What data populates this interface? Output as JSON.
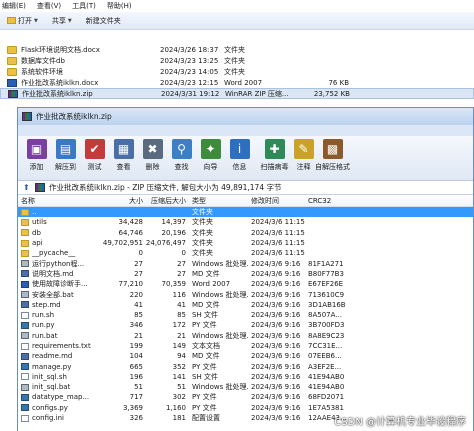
{
  "explorer": {
    "menu": [
      "编辑(E)",
      "查看(V)",
      "工具(T)",
      "帮助(H)"
    ],
    "toolbar": {
      "open": "打开",
      "share": "共享",
      "new_folder": "新建文件夹"
    },
    "files": [
      {
        "name": "Flask环境说明文档.docx",
        "date": "2024/3/26 18:37",
        "type": "文件夹",
        "size": "",
        "icon": "folder-icon"
      },
      {
        "name": "数据库文件db",
        "date": "2024/3/23 13:25",
        "type": "文件夹",
        "size": "",
        "icon": "folder-icon"
      },
      {
        "name": "系统软件环境",
        "date": "2024/3/23 14:05",
        "type": "文件夹",
        "size": "",
        "icon": "folder-icon"
      },
      {
        "name": "作业批改系统iklkn.docx",
        "date": "2024/3/23 12:15",
        "type": "Word 2007",
        "size": "76 KB",
        "icon": "word-doc-icon"
      },
      {
        "name": "作业批改系统iklkn.zip",
        "date": "2024/3/31 19:12",
        "type": "WinRAR ZIP 压缩...",
        "size": "23,752 KB",
        "icon": "winrar-zip-icon"
      }
    ]
  },
  "winrar": {
    "title": "作业批改系统iklkn.zip",
    "toolbar": [
      {
        "label": "添加",
        "icon": "add-icon",
        "color": "#7a3fa0",
        "glyph": "▣"
      },
      {
        "label": "解压到",
        "icon": "extract-to-icon",
        "color": "#3a78c8",
        "glyph": "▤"
      },
      {
        "label": "测试",
        "icon": "test-icon",
        "color": "#c43b3b",
        "glyph": "✔"
      },
      {
        "label": "查看",
        "icon": "view-icon",
        "color": "#4a6fa8",
        "glyph": "▦"
      },
      {
        "label": "删除",
        "icon": "delete-icon",
        "color": "#5a6b80",
        "glyph": "✖"
      },
      {
        "label": "查找",
        "icon": "find-icon",
        "color": "#3b7fc4",
        "glyph": "⚲"
      },
      {
        "label": "向导",
        "icon": "wizard-icon",
        "color": "#3c8c3c",
        "glyph": "✦"
      },
      {
        "label": "信息",
        "icon": "info-icon",
        "color": "#2f6fbf",
        "glyph": "i"
      },
      {
        "label": "扫描病毒",
        "icon": "virus-scan-icon",
        "color": "#2e8b57",
        "glyph": "✚"
      },
      {
        "label": "注释",
        "icon": "comment-icon",
        "color": "#c9a227",
        "glyph": "✎"
      },
      {
        "label": "自解压格式",
        "icon": "sfx-icon",
        "color": "#8a5a2b",
        "glyph": "▩"
      }
    ],
    "address": "作业批改系统iklkn.zip - ZIP 压缩文件, 解包大小为 49,891,174 字节",
    "columns": {
      "name": "名称",
      "size": "大小",
      "packed": "压缩后大小",
      "type": "类型",
      "modified": "修改时间",
      "crc": "CRC32"
    },
    "rows": [
      {
        "name": "..",
        "size": "",
        "packed": "",
        "type": "文件夹",
        "modified": "",
        "crc": "",
        "icon": "updir",
        "selected": true
      },
      {
        "name": "utils",
        "size": "34,428",
        "packed": "14,397",
        "type": "文件夹",
        "modified": "2024/3/6 11:15",
        "crc": "",
        "icon": "folder"
      },
      {
        "name": "db",
        "size": "64,746",
        "packed": "20,196",
        "type": "文件夹",
        "modified": "2024/3/6 11:15",
        "crc": "",
        "icon": "folder"
      },
      {
        "name": "api",
        "size": "49,702,951",
        "packed": "24,076,497",
        "type": "文件夹",
        "modified": "2024/3/6 11:15",
        "crc": "",
        "icon": "folder"
      },
      {
        "name": "__pycache__",
        "size": "0",
        "packed": "0",
        "type": "文件夹",
        "modified": "2024/3/6 11:15",
        "crc": "",
        "icon": "folder"
      },
      {
        "name": "运行python程...",
        "size": "27",
        "packed": "27",
        "type": "Windows 批处理...",
        "modified": "2024/3/6 9:16",
        "crc": "81F1A271",
        "icon": "bat"
      },
      {
        "name": "说明文档.md",
        "size": "27",
        "packed": "27",
        "type": "MD 文件",
        "modified": "2024/3/6 9:16",
        "crc": "B80F77B3",
        "icon": "md"
      },
      {
        "name": "使用故障诊断手...",
        "size": "77,210",
        "packed": "70,359",
        "type": "Word 2007",
        "modified": "2024/3/6 9:16",
        "crc": "E67EF26E",
        "icon": "docx"
      },
      {
        "name": "安装全部.bat",
        "size": "220",
        "packed": "116",
        "type": "Windows 批处理...",
        "modified": "2024/3/6 9:16",
        "crc": "713610C9",
        "icon": "bat"
      },
      {
        "name": "step.md",
        "size": "41",
        "packed": "41",
        "type": "MD 文件",
        "modified": "2024/3/6 9:16",
        "crc": "3D1AB16B",
        "icon": "md"
      },
      {
        "name": "run.sh",
        "size": "85",
        "packed": "85",
        "type": "SH 文件",
        "modified": "2024/3/6 9:16",
        "crc": "8A507A...",
        "icon": "sh"
      },
      {
        "name": "run.py",
        "size": "346",
        "packed": "172",
        "type": "PY 文件",
        "modified": "2024/3/6 9:16",
        "crc": "3B700FD3",
        "icon": "py"
      },
      {
        "name": "run.bat",
        "size": "21",
        "packed": "21",
        "type": "Windows 批处理...",
        "modified": "2024/3/6 9:16",
        "crc": "8A8E9C23",
        "icon": "bat"
      },
      {
        "name": "requirements.txt",
        "size": "199",
        "packed": "149",
        "type": "文本文档",
        "modified": "2024/3/6 9:16",
        "crc": "7CC31E...",
        "icon": "txt"
      },
      {
        "name": "readme.md",
        "size": "104",
        "packed": "94",
        "type": "MD 文件",
        "modified": "2024/3/6 9:16",
        "crc": "07EEB6...",
        "icon": "md"
      },
      {
        "name": "manage.py",
        "size": "665",
        "packed": "352",
        "type": "PY 文件",
        "modified": "2024/3/6 9:16",
        "crc": "A3EF2E...",
        "icon": "py"
      },
      {
        "name": "init_sql.sh",
        "size": "196",
        "packed": "141",
        "type": "SH 文件",
        "modified": "2024/3/6 9:16",
        "crc": "41E94AB0",
        "icon": "sh"
      },
      {
        "name": "init_sql.bat",
        "size": "51",
        "packed": "51",
        "type": "Windows 批处理...",
        "modified": "2024/3/6 9:16",
        "crc": "41E94AB0",
        "icon": "bat"
      },
      {
        "name": "datatype_map...",
        "size": "717",
        "packed": "302",
        "type": "PY 文件",
        "modified": "2024/3/6 9:16",
        "crc": "68FD2071",
        "icon": "py"
      },
      {
        "name": "configs.py",
        "size": "3,369",
        "packed": "1,160",
        "type": "PY 文件",
        "modified": "2024/3/6 9:16",
        "crc": "1E7A5381",
        "icon": "py"
      },
      {
        "name": "config.ini",
        "size": "326",
        "packed": "181",
        "type": "配置设置",
        "modified": "2024/3/6 9:16",
        "crc": "12AAE43...",
        "icon": "txt"
      }
    ]
  },
  "watermark": "CSDN @计算机专业毕设程序"
}
